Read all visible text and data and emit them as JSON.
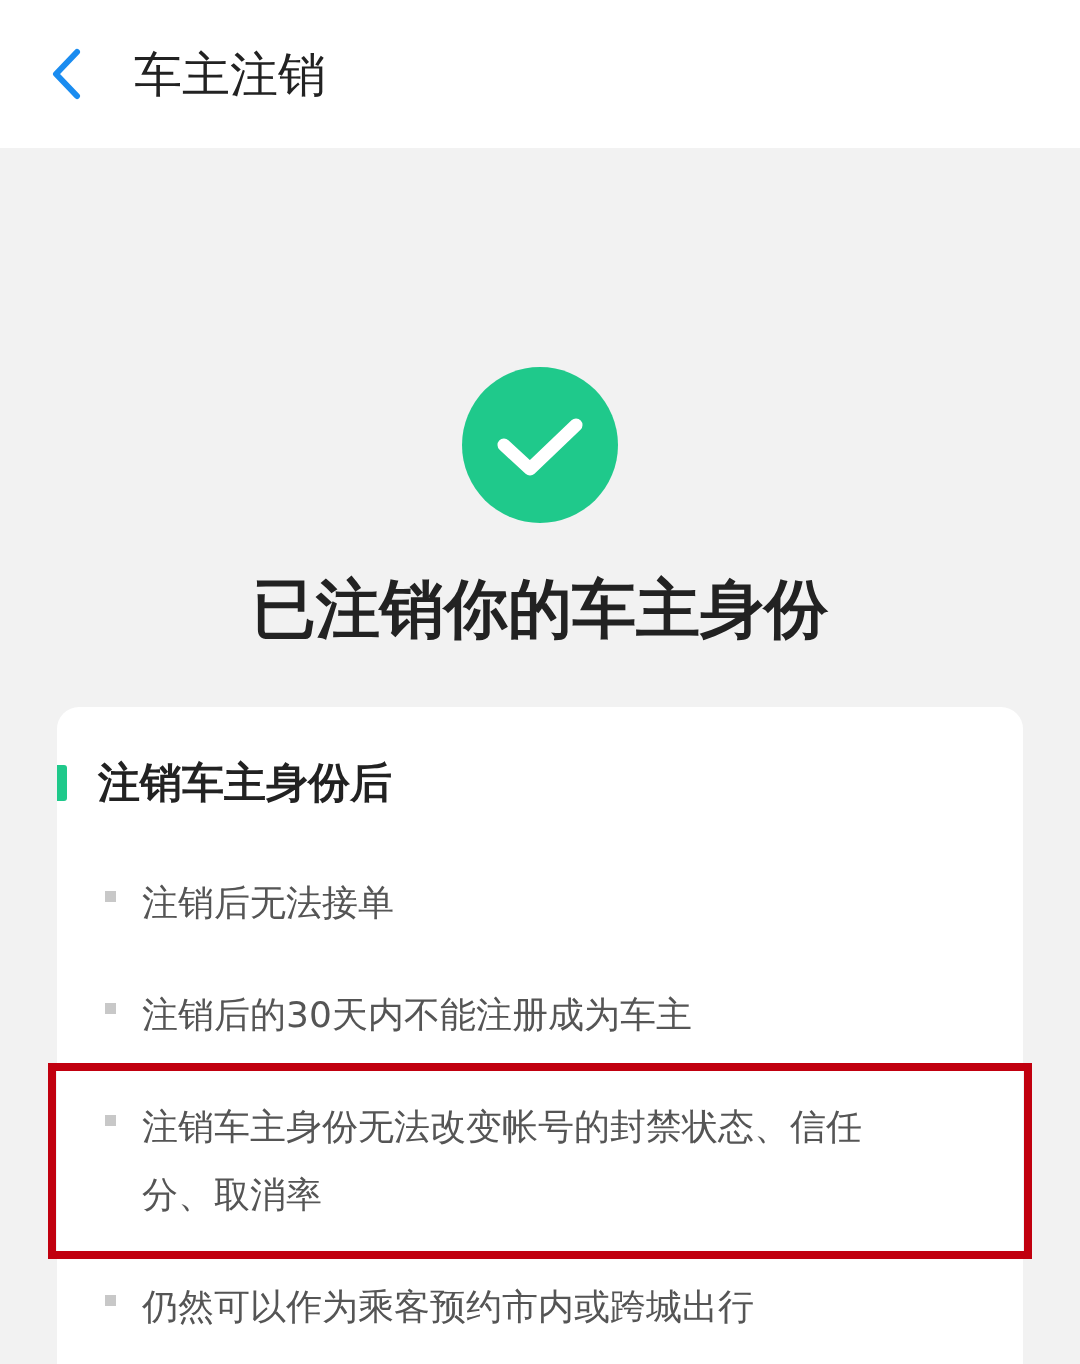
{
  "header": {
    "title": "车主注销"
  },
  "result": {
    "kind": "success",
    "heading": "已注销你的车主身份"
  },
  "card": {
    "title": "注销车主身份后",
    "items": [
      {
        "text": "注销后无法接单",
        "highlighted": false
      },
      {
        "text": "注销后的30天内不能注册成为车主",
        "highlighted": false
      },
      {
        "text": "注销车主身份无法改变帐号的封禁状态、信任分、取消率",
        "highlighted": true
      },
      {
        "text": "仍然可以作为乘客预约市内或跨城出行",
        "highlighted": false
      }
    ]
  }
}
